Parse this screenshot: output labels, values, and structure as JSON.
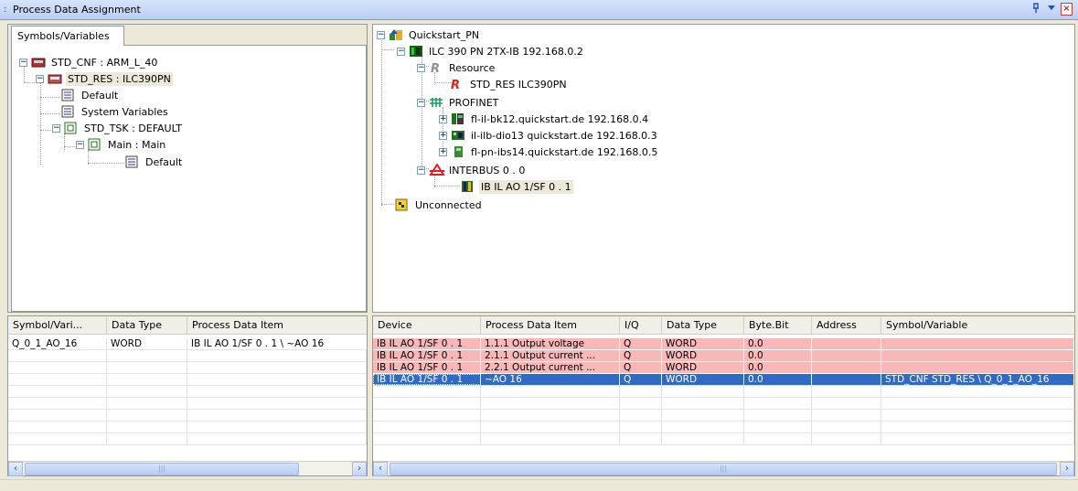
{
  "window": {
    "title": "Process Data Assignment",
    "grip": ":"
  },
  "left_tab": {
    "label": "Symbols/Variables"
  },
  "left_tree": [
    {
      "label": "STD_CNF : ARM_L_40",
      "icon": "configuration-icon"
    },
    {
      "label": "STD_RES : ILC390PN",
      "icon": "resource-icon"
    },
    {
      "label": "Default",
      "icon": "variable-group-icon"
    },
    {
      "label": "System Variables",
      "icon": "variable-group-icon"
    },
    {
      "label": "STD_TSK : DEFAULT",
      "icon": "task-icon"
    },
    {
      "label": "Main : Main",
      "icon": "program-icon"
    },
    {
      "label": "Default",
      "icon": "variable-group-icon"
    }
  ],
  "right_tree": [
    {
      "label": "Quickstart_PN",
      "icon": "project-icon"
    },
    {
      "label": "ILC 390 PN 2TX-IB 192.168.0.2",
      "icon": "controller-icon"
    },
    {
      "label": "Resource",
      "icon": "resource-r-gray-icon"
    },
    {
      "label": "STD_RES ILC390PN",
      "icon": "resource-r-red-icon"
    },
    {
      "label": "PROFINET",
      "icon": "profinet-icon"
    },
    {
      "label": "fl-il-bk12.quickstart.de 192.168.0.4",
      "icon": "bus-coupler-icon"
    },
    {
      "label": "il-ilb-dio13 quickstart.de 192.168.0.3",
      "icon": "io-module-icon"
    },
    {
      "label": "fl-pn-ibs14.quickstart.de 192.168.0.5",
      "icon": "proxy-icon"
    },
    {
      "label": "INTERBUS 0 . 0",
      "icon": "interbus-icon"
    },
    {
      "label": "IB IL AO 1/SF 0 . 1",
      "icon": "analog-module-icon"
    },
    {
      "label": "Unconnected",
      "icon": "unconnected-icon"
    }
  ],
  "left_grid": {
    "columns": [
      "Symbol/Vari...",
      "Data Type",
      "Process Data Item"
    ],
    "rows": [
      [
        "Q_0_1_AO_16",
        "WORD",
        "IB IL AO 1/SF 0 . 1  \\ ~AO 16"
      ]
    ]
  },
  "right_grid": {
    "columns": [
      "Device",
      "Process Data Item",
      "I/Q",
      "Data Type",
      "Byte.Bit",
      "Address",
      "Symbol/Variable"
    ],
    "rows": [
      [
        "IB IL AO 1/SF 0 . 1",
        "1.1.1 Output voltage",
        "Q",
        "WORD",
        "0.0",
        "",
        ""
      ],
      [
        "IB IL AO 1/SF 0 . 1",
        "2.1.1 Output current ...",
        "Q",
        "WORD",
        "0.0",
        "",
        ""
      ],
      [
        "IB IL AO 1/SF 0 . 1",
        "2.2.1 Output current ...",
        "Q",
        "WORD",
        "0.0",
        "",
        ""
      ],
      [
        "IB IL AO 1/SF 0 . 1",
        "~AO 16",
        "Q",
        "WORD",
        "0.0",
        "",
        "STD_CNF STD_RES \\ Q_0_1_AO_16"
      ]
    ]
  },
  "scroll": {
    "left": "‹",
    "right": "›",
    "thumb": "|||"
  },
  "colors": {
    "assigned": "#f8b8b8",
    "selected": "#316ac5"
  }
}
